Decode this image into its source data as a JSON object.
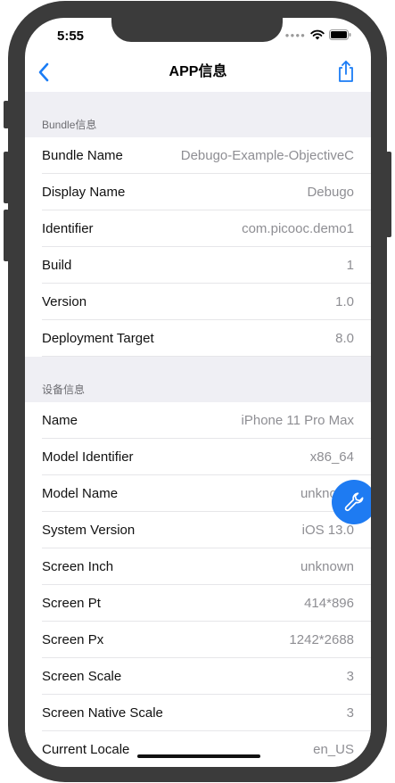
{
  "status_bar": {
    "time": "5:55"
  },
  "navbar": {
    "title": "APP信息"
  },
  "sections": [
    {
      "header": "Bundle信息",
      "rows": [
        {
          "key": "Bundle Name",
          "value": "Debugo-Example-ObjectiveC"
        },
        {
          "key": "Display Name",
          "value": "Debugo"
        },
        {
          "key": "Identifier",
          "value": "com.picooc.demo1"
        },
        {
          "key": "Build",
          "value": "1"
        },
        {
          "key": "Version",
          "value": "1.0"
        },
        {
          "key": "Deployment Target",
          "value": "8.0"
        }
      ]
    },
    {
      "header": "设备信息",
      "rows": [
        {
          "key": "Name",
          "value": "iPhone 11 Pro Max"
        },
        {
          "key": "Model Identifier",
          "value": "x86_64"
        },
        {
          "key": "Model Name",
          "value": "unknown"
        },
        {
          "key": "System Version",
          "value": "iOS 13.0"
        },
        {
          "key": "Screen Inch",
          "value": "unknown"
        },
        {
          "key": "Screen Pt",
          "value": "414*896"
        },
        {
          "key": "Screen Px",
          "value": "1242*2688"
        },
        {
          "key": "Screen Scale",
          "value": "3"
        },
        {
          "key": "Screen Native Scale",
          "value": "3"
        },
        {
          "key": "Current Locale",
          "value": "en_US"
        }
      ]
    }
  ],
  "icons": {
    "back": "chevron-left-icon",
    "share": "share-icon",
    "debug_tool": "wrench-icon"
  },
  "colors": {
    "accent": "#1e7bf2",
    "section_bg": "#efeff4"
  }
}
